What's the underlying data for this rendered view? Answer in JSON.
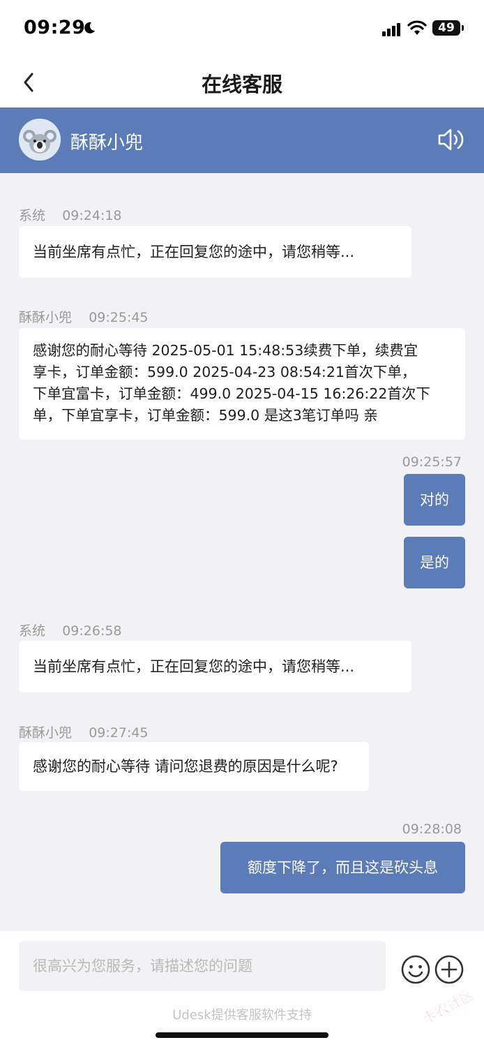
{
  "status_bar": {
    "time": "09:29",
    "battery": "49"
  },
  "nav": {
    "title": "在线客服"
  },
  "agent": {
    "name": "酥酥小兜"
  },
  "messages": [
    {
      "sender": "系统",
      "time": "09:24:18",
      "text": "当前坐席有点忙，正在回复您的途中，请您稍等..."
    },
    {
      "sender": "酥酥小兜",
      "time": "09:25:45",
      "lines": [
        "感谢您的耐心等待 2025-05-01 15:48:53续费下单，续费宜",
        "享卡，订单金额：599.0 2025-04-23 08:54:21首次下单，",
        "下单宜富卡，订单金额：499.0 2025-04-15 16:26:22首次下",
        "单，下单宜享卡，订单金额：599.0 是这3笔订单吗 亲"
      ]
    },
    {
      "time": "09:25:57",
      "texts": [
        "对的",
        "是的"
      ]
    },
    {
      "sender": "系统",
      "time": "09:26:58",
      "text": "当前坐席有点忙，正在回复您的途中，请您稍等..."
    },
    {
      "sender": "酥酥小兜",
      "time": "09:27:45",
      "text": "感谢您的耐心等待 请问您退费的原因是什么呢?"
    },
    {
      "time": "09:28:08",
      "text": "额度下降了，而且这是砍头息"
    }
  ],
  "input": {
    "placeholder": "很高兴为您服务，请描述您的问题"
  },
  "footer": {
    "powered_by": "Udesk提供客服软件支持"
  },
  "watermark": {
    "text": "卡农社区"
  },
  "icons": [
    "moon-icon",
    "signal-icon",
    "wifi-icon",
    "back-icon",
    "koala-avatar",
    "speaker-icon",
    "emoji-icon",
    "plus-icon"
  ],
  "colors": {
    "accent": "#5c7cb8",
    "background": "#f2f2f4",
    "bubble_in": "#ffffff",
    "meta_text": "#9a9a9a",
    "watermark_red": "#d9262a"
  }
}
